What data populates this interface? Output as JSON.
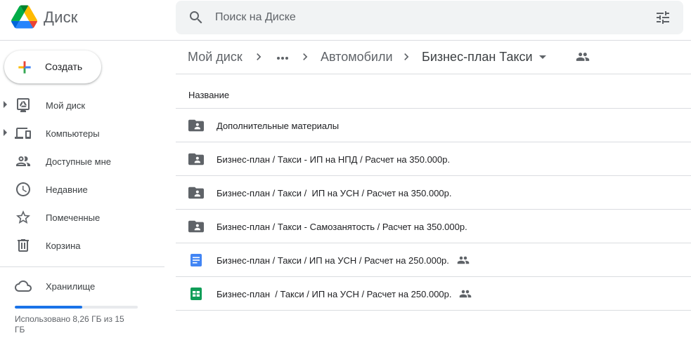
{
  "header": {
    "app_name": "Диск",
    "search_placeholder": "Поиск на Диске"
  },
  "sidebar": {
    "create_label": "Создать",
    "items": [
      {
        "label": "Мой диск",
        "icon": "my-drive-icon",
        "expandable": true
      },
      {
        "label": "Компьютеры",
        "icon": "computers-icon",
        "expandable": true
      },
      {
        "label": "Доступные мне",
        "icon": "shared-people-icon",
        "expandable": false
      },
      {
        "label": "Недавние",
        "icon": "clock-icon",
        "expandable": false
      },
      {
        "label": "Помеченные",
        "icon": "star-icon",
        "expandable": false
      },
      {
        "label": "Корзина",
        "icon": "trash-icon",
        "expandable": false
      }
    ],
    "storage": {
      "label": "Хранилище",
      "used_fraction": 0.55,
      "usage_text": "Использовано 8,26 ГБ из 15 ГБ"
    }
  },
  "breadcrumb": {
    "root": "Мой диск",
    "more": "•••",
    "middle": "Автомобили",
    "current": "Бизнес-план Такси"
  },
  "list": {
    "column_name": "Название",
    "rows": [
      {
        "name": "Дополнительные материалы",
        "type": "shared-folder",
        "shared": false
      },
      {
        "name": "Бизнес-план / Такси - ИП на НПД / Расчет на 350.000р.",
        "type": "shared-folder",
        "shared": false
      },
      {
        "name": "Бизнес-план / Такси /  ИП на УСН / Расчет на 350.000р.",
        "type": "shared-folder",
        "shared": false
      },
      {
        "name": "Бизнес-план / Такси - Самозанятость / Расчет на 350.000р.",
        "type": "shared-folder",
        "shared": false
      },
      {
        "name": "Бизнес-план / Такси / ИП на УСН / Расчет на 250.000р.",
        "type": "google-doc",
        "shared": true
      },
      {
        "name": "Бизнес-план  / Такси / ИП на УСН / Расчет на 250.000р.",
        "type": "google-sheet",
        "shared": true
      }
    ]
  },
  "colors": {
    "accent_blue": "#1a73e8",
    "folder_gray": "#5f6368",
    "docs_blue": "#4285f4",
    "sheets_green": "#0f9d58"
  }
}
